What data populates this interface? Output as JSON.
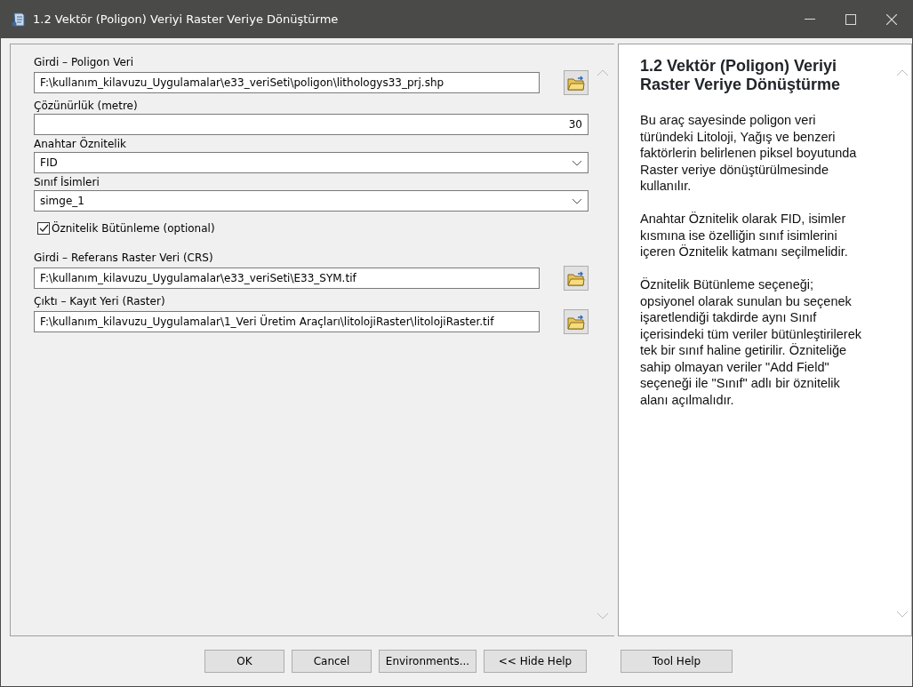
{
  "window": {
    "title": "1.2 Vektör (Poligon) Veriyi Raster Veriye Dönüştürme"
  },
  "parameters": [
    {
      "kind": "file",
      "label": "Girdi – Poligon Veri",
      "value": "F:\\kullanım_kilavuzu_Uygulamalar\\e33_veriSeti\\poligon\\lithologys33_prj.shp"
    },
    {
      "kind": "number",
      "label": "Çözünürlük (metre)",
      "value": "30"
    },
    {
      "kind": "dropdown",
      "label": "Anahtar Öznitelik",
      "value": "FID"
    },
    {
      "kind": "dropdown",
      "label": "Sınıf İsimleri",
      "value": "simge_1"
    },
    {
      "kind": "checkbox",
      "label": "Öznitelik Bütünleme (optional)",
      "checked": true
    },
    {
      "kind": "file",
      "label": "Girdi – Referans Raster Veri (CRS)",
      "value": "F:\\kullanım_kilavuzu_Uygulamalar\\e33_veriSeti\\E33_SYM.tif"
    },
    {
      "kind": "file",
      "label": "Çıktı – Kayıt Yeri (Raster)",
      "value": "F:\\kullanım_kilavuzu_Uygulamalar\\1_Veri Üretim Araçları\\litolojiRaster\\litolojiRaster.tif"
    }
  ],
  "help": {
    "title": "1.2 Vektör (Poligon) Veriyi Raster Veriye Dönüştürme",
    "paragraphs": [
      "Bu araç sayesinde poligon veri türündeki Litoloji, Yağış ve benzeri faktörlerin belirlenen piksel boyutunda Raster veriye dönüştürülmesinde kullanılır.",
      "Anahtar Öznitelik olarak FID, isimler kısmına ise özelliğin sınıf isimlerini içeren Öznitelik katmanı seçilmelidir.",
      "Öznitelik Bütünleme seçeneği; opsiyonel olarak sunulan bu seçenek işaretlendiği takdirde aynı Sınıf içerisindeki tüm veriler bütünleştirilerek tek bir sınıf haline getirilir. Özniteliğe sahip olmayan veriler \"Add Field\" seçeneği ile \"Sınıf\" adlı bir öznitelik alanı açılmalıdır."
    ]
  },
  "buttons": [
    "OK",
    "Cancel",
    "Environments...",
    "<< Hide Help",
    "Tool Help"
  ]
}
